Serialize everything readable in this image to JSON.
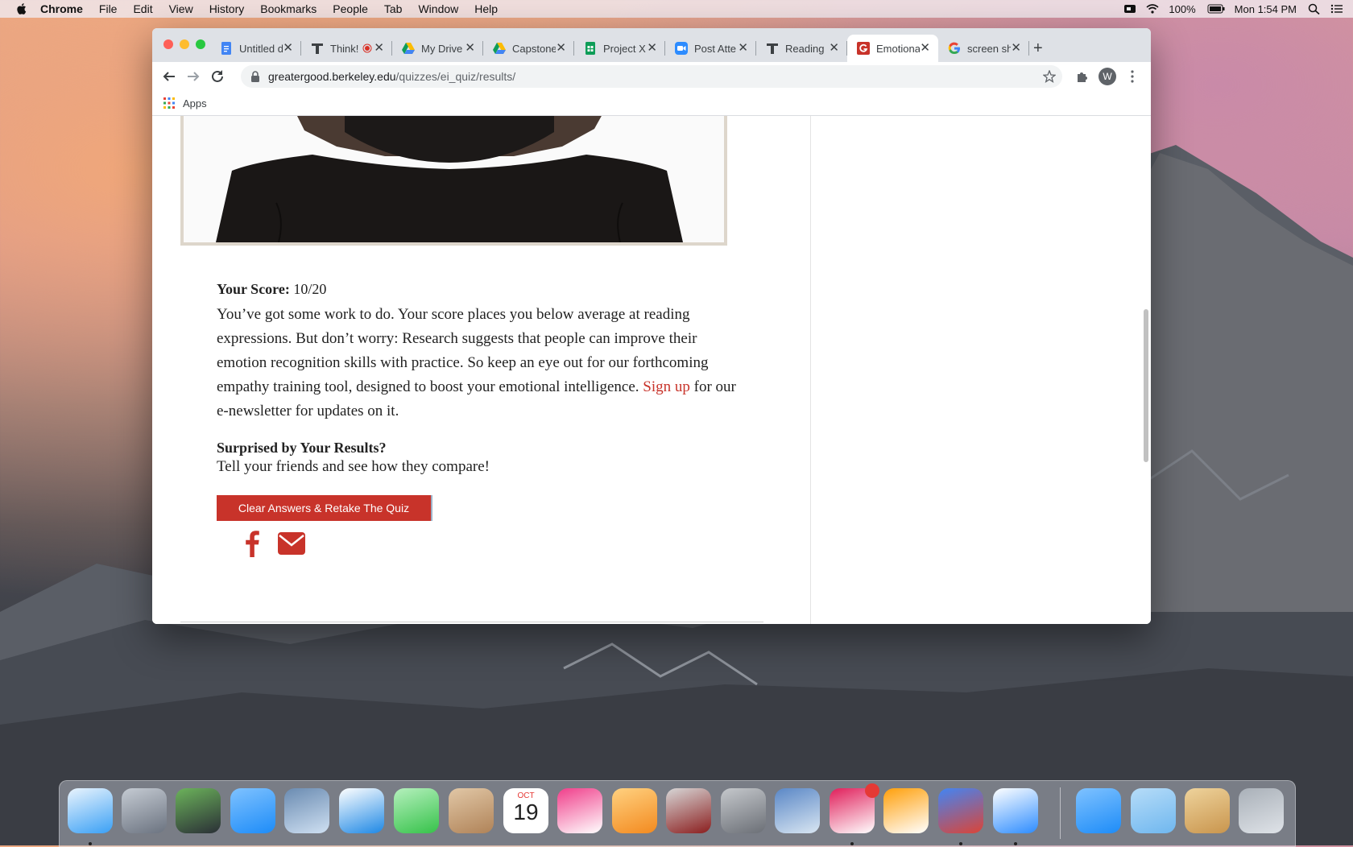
{
  "menubar": {
    "app": "Chrome",
    "items": [
      "File",
      "Edit",
      "View",
      "History",
      "Bookmarks",
      "People",
      "Tab",
      "Window",
      "Help"
    ],
    "battery": "100%",
    "clock": "Mon 1:54 PM"
  },
  "browser": {
    "tabs": [
      {
        "label": "Untitled d",
        "icon": "google-docs-icon"
      },
      {
        "label": "Think!",
        "icon": "thinkific-icon"
      },
      {
        "label": "My Drive",
        "icon": "google-drive-icon"
      },
      {
        "label": "Capstone",
        "icon": "google-drive-icon"
      },
      {
        "label": "Project X",
        "icon": "google-sheets-icon"
      },
      {
        "label": "Post Atte",
        "icon": "zoom-icon"
      },
      {
        "label": "Reading",
        "icon": "thinkific-icon"
      },
      {
        "label": "Emotiona",
        "icon": "greater-good-icon",
        "active": true
      },
      {
        "label": "screen sh",
        "icon": "google-icon"
      }
    ],
    "url_domain": "greatergood.berkeley.edu",
    "url_path": "/quizzes/ei_quiz/results/",
    "avatar_initial": "W",
    "bookmarks_apps": "Apps"
  },
  "page": {
    "score_label": "Your Score:",
    "score_value": "10/20",
    "result_before_link": "You’ve got some work to do. Your score places you below average at reading expressions. But don’t worry: Research suggests that people can improve their emotion recognition skills with practice. So keep an eye out for our forthcoming empathy training tool, designed to boost your emotional intelligence. ",
    "signup_link": "Sign up",
    "result_after_link": " for our e-newsletter for updates on it.",
    "surprised_heading": "Surprised by Your Results?",
    "tell_friends": "Tell your friends and see how they compare!",
    "retake_button": "Clear Answers & Retake The Quiz"
  },
  "social_sidebar": {
    "colors": {
      "facebook": "#3b5998",
      "twitter": "#1da1f2",
      "linkedin": "#0077b5",
      "more": "#f25f4f"
    }
  },
  "colors": {
    "accent": "#c8332a"
  },
  "dock": {
    "items": [
      "finder-icon",
      "launchpad-icon",
      "mission-control-icon",
      "app-store-icon",
      "mail-icon",
      "safari-icon",
      "facetime-icon",
      "contacts-icon",
      "calendar-icon",
      "itunes-icon",
      "ibooks-icon",
      "photo-booth-icon",
      "system-preferences-icon",
      "preview-icon",
      "slack-icon",
      "photos-icon",
      "chrome-icon",
      "zoom-icon",
      "app-store-icon",
      "downloads-folder-icon",
      "installer-icon",
      "trash-icon"
    ],
    "calendar_month": "OCT",
    "calendar_day": "19"
  }
}
